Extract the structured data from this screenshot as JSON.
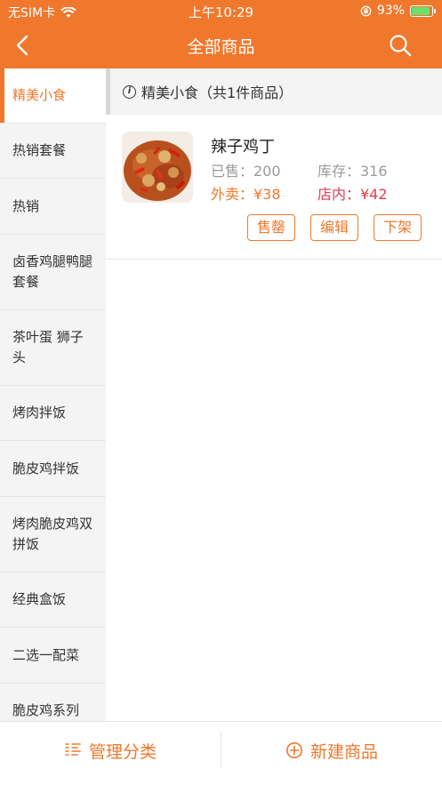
{
  "status_bar": {
    "carrier": "无SIM卡",
    "time": "上午10:29",
    "battery": "93%",
    "battery_level": 0.93
  },
  "nav": {
    "title": "全部商品"
  },
  "sidebar": {
    "items": [
      {
        "label": "精美小食",
        "active": true
      },
      {
        "label": "热销套餐"
      },
      {
        "label": "热销"
      },
      {
        "label": "卤香鸡腿鸭腿套餐"
      },
      {
        "label": "茶叶蛋 狮子头"
      },
      {
        "label": "烤肉拌饭"
      },
      {
        "label": "脆皮鸡拌饭"
      },
      {
        "label": "烤肉脆皮鸡双拼饭"
      },
      {
        "label": "经典盒饭"
      },
      {
        "label": "二选一配菜"
      },
      {
        "label": "脆皮鸡系列"
      }
    ]
  },
  "category_header": {
    "text": "精美小食（共1件商品）"
  },
  "products": [
    {
      "name": "辣子鸡丁",
      "sold": "已售：200",
      "stock": "库存：316",
      "takeout_price": "外卖：¥38",
      "instore_price": "店内：¥42",
      "actions": {
        "sold_out": "售罄",
        "edit": "编辑",
        "remove": "下架"
      }
    }
  ],
  "bottom_bar": {
    "manage_category": "管理分类",
    "new_product": "新建商品"
  },
  "colors": {
    "accent": "#F0782D",
    "instore_price": "#E03B53",
    "sidebar_bg": "#F4F4F4"
  }
}
